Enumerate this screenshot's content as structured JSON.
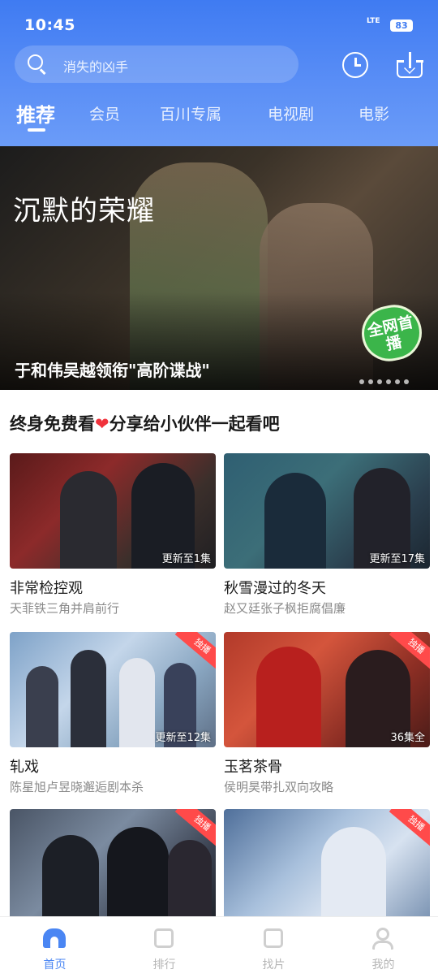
{
  "status_bar": {
    "time": "10:45",
    "network": "LTE",
    "battery": "83"
  },
  "search": {
    "placeholder": "消失的凶手"
  },
  "icons": {
    "history": "history-clock-icon",
    "download": "download-icon"
  },
  "tabs": [
    {
      "label": "推荐",
      "active": true
    },
    {
      "label": "会员"
    },
    {
      "label": "百川专属"
    },
    {
      "label": "电视剧"
    },
    {
      "label": "电影"
    }
  ],
  "banner": {
    "title": "沉默的荣耀",
    "caption": "于和伟吴越领衔\"高阶谍战\"",
    "live_badge": "全网首播",
    "dots": 6
  },
  "section": {
    "title_pre": "终身免费看",
    "title_post": "分享给小伙伴一起看吧",
    "heart": "❤"
  },
  "cards": [
    {
      "title": "非常检控观",
      "desc": "天菲铁三角并肩前行",
      "badge": "更新至1集",
      "tag": ""
    },
    {
      "title": "秋雪漫过的冬天",
      "desc": "赵又廷张子枫拒腐倡廉",
      "badge": "更新至17集",
      "tag": ""
    },
    {
      "title": "轧戏",
      "desc": "陈星旭卢昱晓邂逅剧本杀",
      "badge": "更新至12集",
      "tag": "独播"
    },
    {
      "title": "玉茗茶骨",
      "desc": "侯明昊带扎双向攻略",
      "badge": "36集全",
      "tag": "独播"
    },
    {
      "title": "",
      "desc": "",
      "badge": "",
      "tag": "独播"
    },
    {
      "title": "",
      "desc": "",
      "badge": "",
      "tag": "独播"
    }
  ],
  "bottom_nav": [
    {
      "label": "首页",
      "active": true
    },
    {
      "label": "排行"
    },
    {
      "label": "找片"
    },
    {
      "label": "我的"
    }
  ],
  "colors": {
    "primary": "#4a86f3",
    "header_top": "#3f7bf2",
    "tag_red": "#ff4a4a",
    "live_green": "#3bb54a"
  }
}
